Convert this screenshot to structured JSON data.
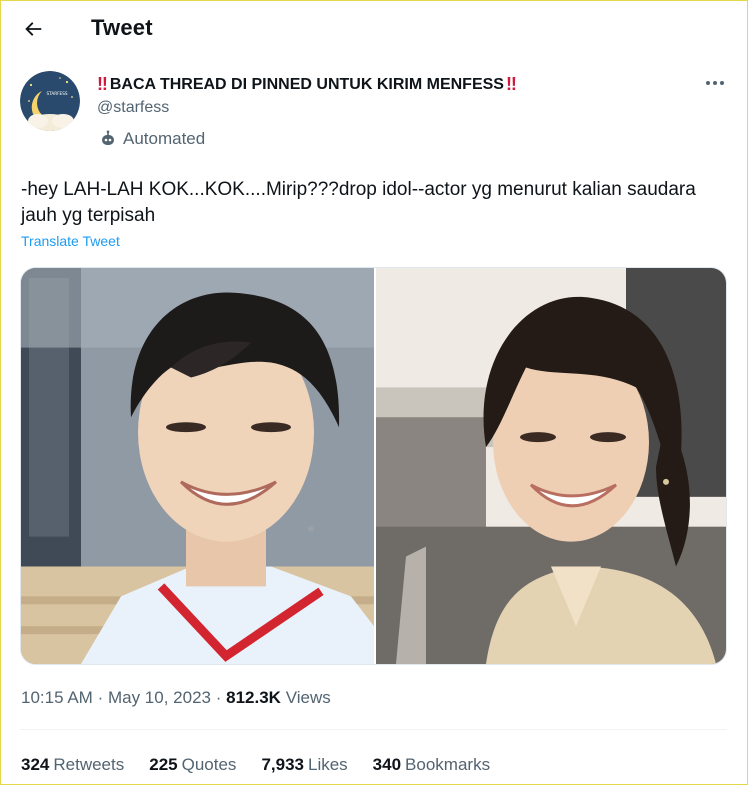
{
  "header": {
    "title": "Tweet",
    "back_icon": "arrow-left-icon"
  },
  "author": {
    "display_name_text": "BACA THREAD DI PINNED UNTUK KIRIM MENFESS",
    "display_name_emoji": "‼",
    "handle": "@starfess",
    "label": "Automated",
    "label_icon": "bot-icon",
    "avatar_text": "STARFESS"
  },
  "tweet": {
    "text": "-hey LAH-LAH KOK...KOK....Mirip???drop idol--actor yg menurut kalian saudara jauh yg terpisah",
    "translate_label": "Translate Tweet"
  },
  "meta": {
    "time": "10:15 AM",
    "date": "May 10, 2023",
    "separator": "·",
    "views_count": "812.3K",
    "views_label": "Views"
  },
  "stats": {
    "retweets_count": "324",
    "retweets_label": "Retweets",
    "quotes_count": "225",
    "quotes_label": "Quotes",
    "likes_count": "7,933",
    "likes_label": "Likes",
    "bookmarks_count": "340",
    "bookmarks_label": "Bookmarks"
  },
  "colors": {
    "accent": "#1d9bf0",
    "text_primary": "#0f1419",
    "text_secondary": "#536471",
    "emoji_red": "#d0193d",
    "frame_border": "#e6d84a"
  }
}
